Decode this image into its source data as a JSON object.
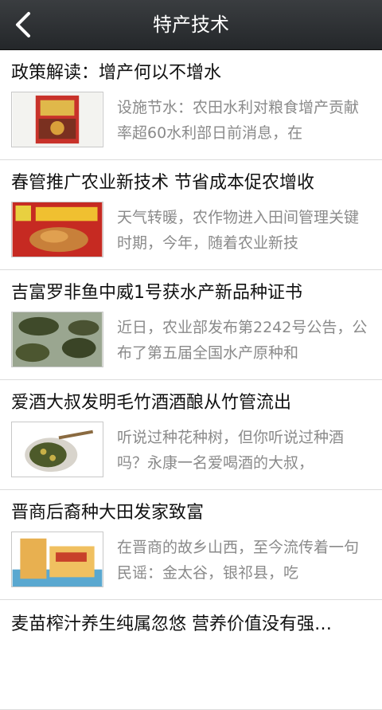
{
  "header": {
    "title": "特产技术",
    "back_icon": "chevron-left-icon"
  },
  "articles": [
    {
      "title": "政策解读：增产何以不增水",
      "summary": "设施节水：农田水利对粮食增产贡献率超60水利部日前消息，在",
      "thumb_icon": "product-bag-image"
    },
    {
      "title": "春管推广农业新技术 节省成本促农增收",
      "summary": "天气转暖，农作物进入田间管理关键时期，今年，随着农业新技",
      "thumb_icon": "roast-chicken-package-image"
    },
    {
      "title": "吉富罗非鱼中威1号获水产新品种证书",
      "summary": "近日，农业部发布第2242号公告，公布了第五届全国水产原种和",
      "thumb_icon": "turtles-image"
    },
    {
      "title": "爱酒大叔发明毛竹酒酒酿从竹管流出",
      "summary": "听说过种花种树，但你听说过种酒吗？永康一名爱喝酒的大叔，",
      "thumb_icon": "tea-leaves-plate-image"
    },
    {
      "title": "晋商后裔种大田发家致富",
      "summary": "在晋商的故乡山西，至今流传着一句民谣：金太谷，银祁县，吃",
      "thumb_icon": "gift-box-image"
    },
    {
      "title": "麦苗榨汁养生纯属忽悠 营养价值没有强…",
      "summary": "",
      "thumb_icon": ""
    }
  ]
}
